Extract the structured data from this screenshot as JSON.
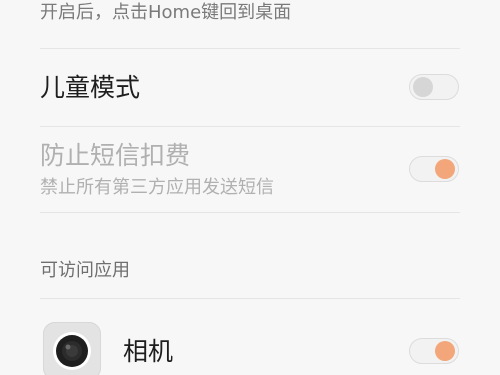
{
  "header_note": "开启后，点击Home键回到桌面",
  "settings": {
    "kids_mode": {
      "label": "儿童模式",
      "enabled": false
    },
    "block_sms_charges": {
      "label": "防止短信扣费",
      "description": "禁止所有第三方应用发送短信",
      "enabled": true
    }
  },
  "apps_section": {
    "header": "可访问应用",
    "apps": [
      {
        "name": "相机",
        "icon": "camera-icon",
        "enabled": true
      }
    ]
  },
  "colors": {
    "toggle_on_knob": "#f2a679",
    "toggle_off_knob": "#d6d6d6",
    "background": "#f7f7f7"
  }
}
